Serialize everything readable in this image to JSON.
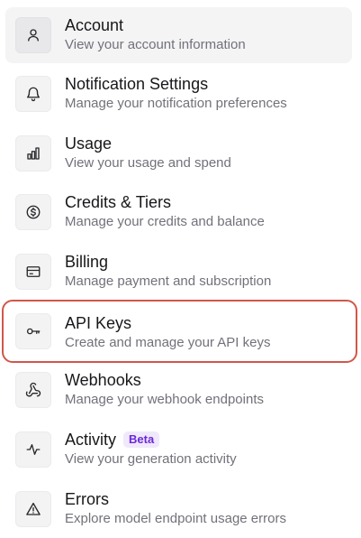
{
  "menu": {
    "items": [
      {
        "title": "Account",
        "subtitle": "View your account information",
        "icon": "user-icon"
      },
      {
        "title": "Notification Settings",
        "subtitle": "Manage your notification preferences",
        "icon": "bell-icon"
      },
      {
        "title": "Usage",
        "subtitle": "View your usage and spend",
        "icon": "bar-chart-icon"
      },
      {
        "title": "Credits & Tiers",
        "subtitle": "Manage your credits and balance",
        "icon": "dollar-circle-icon"
      },
      {
        "title": "Billing",
        "subtitle": "Manage payment and subscription",
        "icon": "credit-card-icon"
      },
      {
        "title": "API Keys",
        "subtitle": "Create and manage your API keys",
        "icon": "key-icon"
      },
      {
        "title": "Webhooks",
        "subtitle": "Manage your webhook endpoints",
        "icon": "webhook-icon"
      },
      {
        "title": "Activity",
        "badge": "Beta",
        "subtitle": "View your generation activity",
        "icon": "activity-icon"
      },
      {
        "title": "Errors",
        "subtitle": "Explore model endpoint usage errors",
        "icon": "warning-triangle-icon"
      }
    ]
  },
  "colors": {
    "highlight_border": "#d0574a",
    "active_background": "#f4f4f5",
    "badge_text": "#6d28d9",
    "badge_background": "#f0e9fb"
  }
}
